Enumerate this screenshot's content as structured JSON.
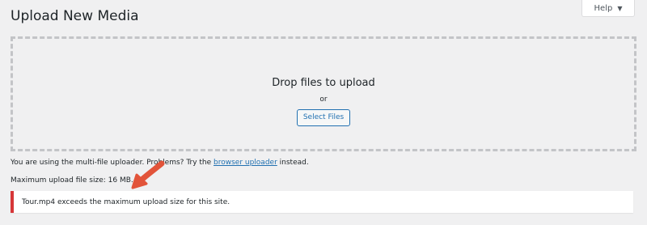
{
  "header": {
    "title": "Upload New Media",
    "help_label": "Help",
    "help_caret_icon": "caret-down-icon"
  },
  "dropzone": {
    "title": "Drop files to upload",
    "or_text": "or",
    "select_button_label": "Select Files"
  },
  "notes": {
    "multi_uploader_prefix": "You are using the multi-file uploader. Problems? Try the ",
    "browser_uploader_link": "browser uploader",
    "multi_uploader_suffix": " instead.",
    "max_upload_size": "Maximum upload file size: 16 MB."
  },
  "error": {
    "message": "Tour.mp4 exceeds the maximum upload size for this site."
  },
  "colors": {
    "accent": "#2271b1",
    "error": "#d63638",
    "annotation_arrow": "#e2543a",
    "background": "#f0f0f1"
  }
}
